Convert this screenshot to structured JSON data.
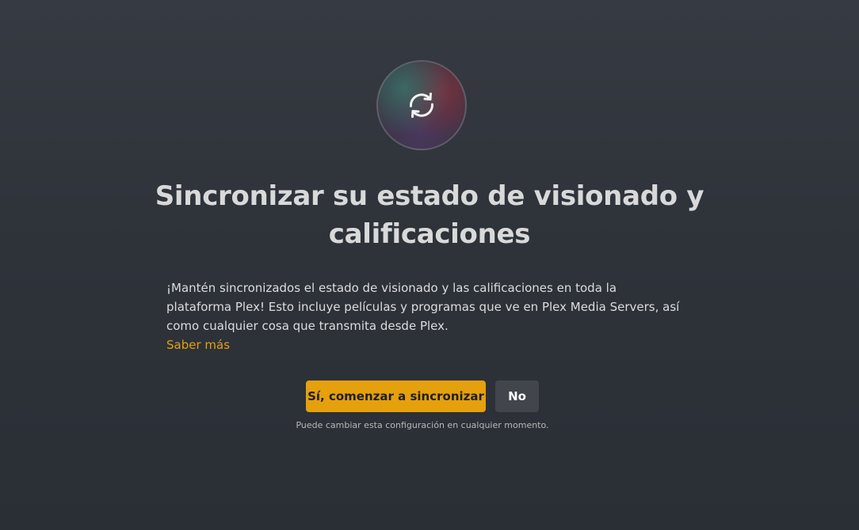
{
  "sync_icon": {
    "name": "sync-icon"
  },
  "title": "Sincronizar su estado de visionado y calificaciones",
  "description": "¡Mantén sincronizados el estado de visionado y las calificaciones en toda la plataforma Plex! Esto incluye películas y programas que ve en Plex Media Servers, así como cualquier cosa que transmita desde Plex.",
  "learn_more_label": "Saber más",
  "buttons": {
    "yes_label": "Sí, comenzar a sincronizar",
    "no_label": "No"
  },
  "hint": "Puede cambiar esta configuración en cualquier momento.",
  "colors": {
    "accent": "#e5a00d",
    "background": "#2e333a",
    "secondary_button": "#42454c"
  }
}
